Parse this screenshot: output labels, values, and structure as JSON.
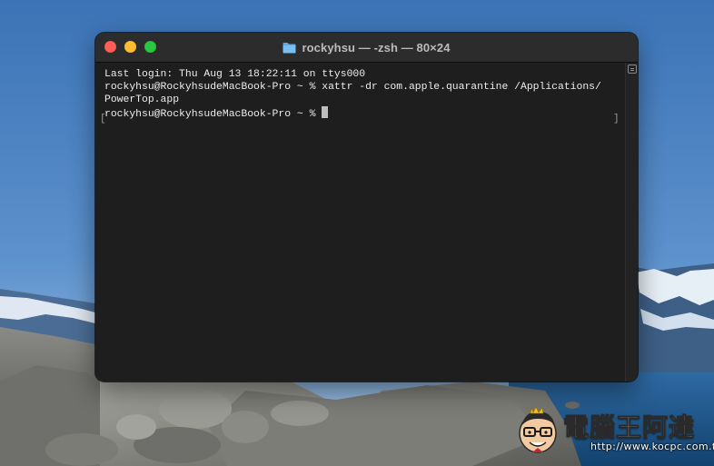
{
  "window": {
    "title": "rockyhsu — -zsh — 80×24",
    "title_icon": "folder-icon"
  },
  "terminal": {
    "lines": [
      "Last login: Thu Aug 13 18:22:11 on ttys000",
      "rockyhsu@RockyhsudeMacBook-Pro ~ % xattr -dr com.apple.quarantine /Applications/",
      "PowerTop.app",
      "rockyhsu@RockyhsudeMacBook-Pro ~ % "
    ],
    "bracket_left": "[",
    "bracket_right": "]"
  },
  "watermark": {
    "text": "電腦王阿達",
    "url": "http://www.kocpc.com.tw"
  },
  "colors": {
    "terminal_bg": "#1e1e1e",
    "titlebar_bg": "#2c2c2c",
    "text": "#ededed",
    "close": "#ff5f57",
    "minimize": "#febc2e",
    "zoom": "#28c840"
  }
}
